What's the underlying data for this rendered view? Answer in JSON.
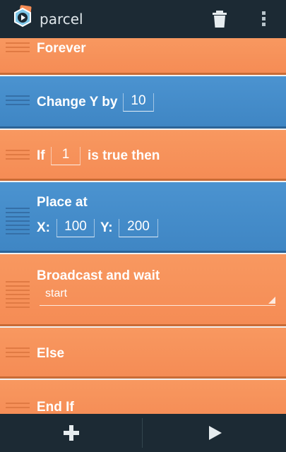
{
  "app": {
    "title": "parcel"
  },
  "toolbar": {
    "trash_icon": "trash-icon",
    "overflow_icon": "overflow-menu-icon"
  },
  "bricks": {
    "forever": {
      "label": "Forever",
      "color": "#f58c55"
    },
    "change_y": {
      "label": "Change Y by",
      "value": "10",
      "color": "#3f86c4"
    },
    "if": {
      "label_prefix": "If",
      "value": "1",
      "label_suffix": "is true then",
      "color": "#f58c55"
    },
    "place_at": {
      "label": "Place at",
      "x_label": "X:",
      "x_value": "100",
      "y_label": "Y:",
      "y_value": "200",
      "color": "#3f86c4"
    },
    "broadcast_wait": {
      "label": "Broadcast and wait",
      "selected_message": "start",
      "color": "#f58c55"
    },
    "else": {
      "label": "Else",
      "color": "#f58c55"
    },
    "end_if": {
      "label": "End If",
      "color": "#f58c55"
    }
  },
  "bottom_bar": {
    "add_icon": "plus-icon",
    "play_icon": "play-icon"
  },
  "colors": {
    "bar_background": "#1c2a34",
    "brick_orange": "#f58c55",
    "brick_blue": "#3f86c4"
  }
}
